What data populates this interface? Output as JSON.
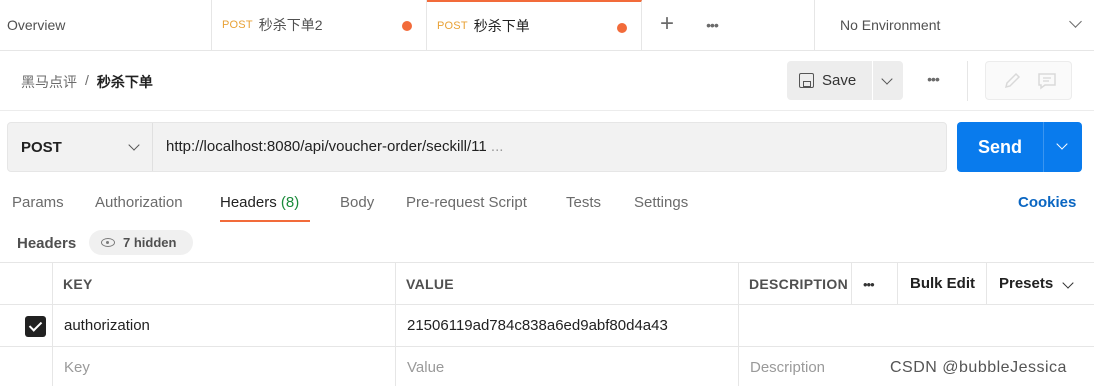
{
  "tabs": {
    "overview": "Overview",
    "items": [
      {
        "method": "POST",
        "name": "秒杀下单2",
        "unsaved": true
      },
      {
        "method": "POST",
        "name": "秒杀下单",
        "unsaved": true
      }
    ],
    "add_icon": "plus-icon",
    "more_icon": "ellipsis-icon",
    "env_label": "No Environment"
  },
  "breadcrumb": {
    "parent": "黑马点评",
    "separator": "/",
    "current": "秒杀下单"
  },
  "toolbar": {
    "save_label": "Save",
    "save_icon": "save-icon",
    "edit_icon": "pencil-icon",
    "comment_icon": "comment-icon"
  },
  "request": {
    "method": "POST",
    "url": "http://localhost:8080/api/voucher-order/seckill/11",
    "url_ellipsis": "...",
    "send_label": "Send"
  },
  "request_tabs": {
    "params": "Params",
    "authorization": "Authorization",
    "headers": "Headers",
    "headers_count": "(8)",
    "body": "Body",
    "prerequest": "Pre-request Script",
    "tests": "Tests",
    "settings": "Settings",
    "cookies": "Cookies"
  },
  "headers_section": {
    "title": "Headers",
    "hidden_label": "7 hidden"
  },
  "table": {
    "col_key": "KEY",
    "col_value": "VALUE",
    "col_description": "DESCRIPTION",
    "bulk_edit": "Bulk Edit",
    "presets": "Presets",
    "rows": [
      {
        "checked": true,
        "key": "authorization",
        "value": "21506119ad784c838a6ed9abf80d4a43",
        "description": ""
      }
    ],
    "placeholder_key": "Key",
    "placeholder_value": "Value",
    "placeholder_description": "Description"
  },
  "watermark": "CSDN @bubbleJessica",
  "colors": {
    "accent": "#f26b3a",
    "send": "#097bed",
    "link": "#0a66c2",
    "count": "#1a8a3a"
  }
}
